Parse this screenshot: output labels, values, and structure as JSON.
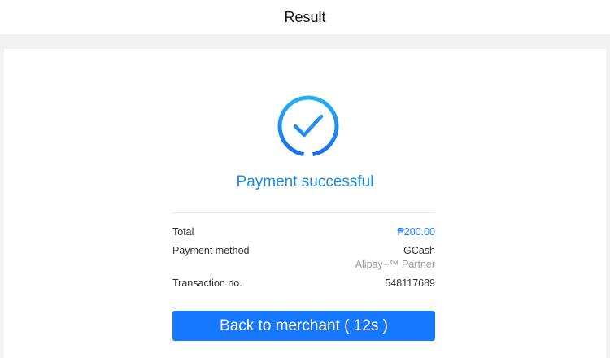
{
  "header": {
    "title": "Result"
  },
  "result": {
    "icon": "check-circle-icon",
    "status_text": "Payment successful"
  },
  "details": {
    "total_label": "Total",
    "total_value": "₱200.00",
    "method_label": "Payment method",
    "method_value": "GCash",
    "method_sub": "Alipay+™ Partner",
    "txn_label": "Transaction no.",
    "txn_value": "548117689"
  },
  "actions": {
    "back_label": "Back to merchant ( 12s )"
  },
  "colors": {
    "accent": "#1677ff",
    "status_text": "#1a8ce8",
    "icon_ring_start": "#27b0f5",
    "icon_ring_end": "#1a6fe8"
  }
}
